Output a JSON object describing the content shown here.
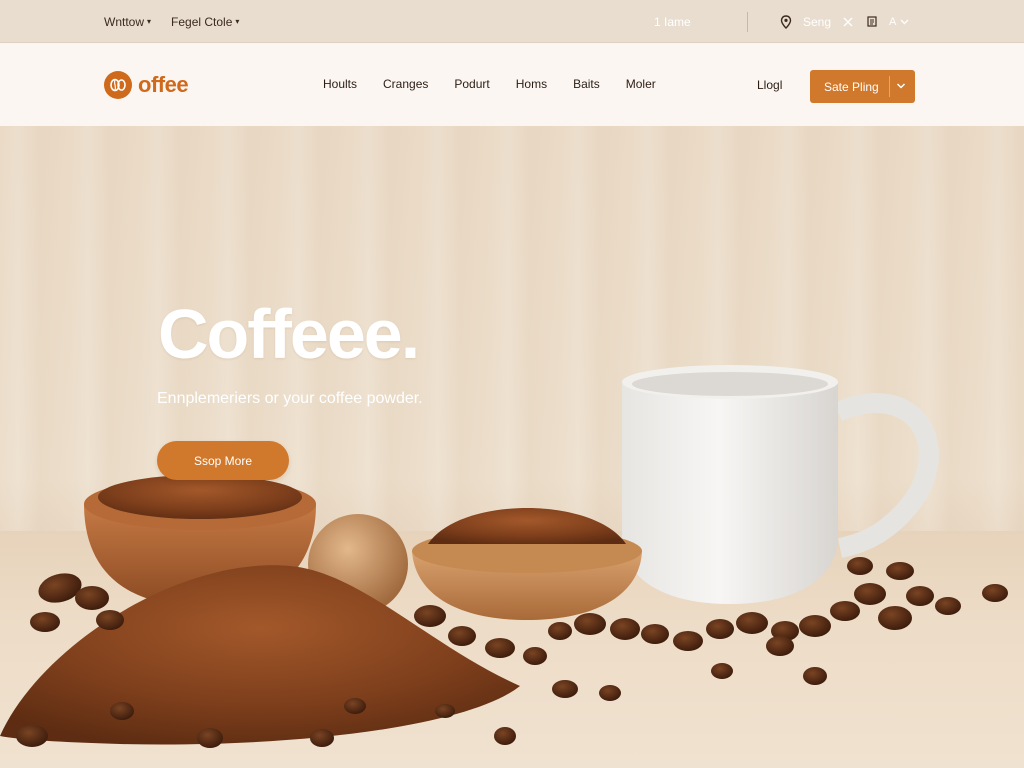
{
  "utility": {
    "left_menus": [
      {
        "label": "Wnttow"
      },
      {
        "label": "Fegel Ctole"
      }
    ],
    "home": "1 Iame",
    "sing": "Seng",
    "lang": "A"
  },
  "nav": {
    "logo_text": "offee",
    "links": [
      "Hoults",
      "Cranges",
      "Podurt",
      "Homs",
      "Baits",
      "Moler"
    ],
    "login": "Llogl",
    "cta_label": "Sate Pling"
  },
  "hero": {
    "title": "Coffeee.",
    "subtitle": "Ennplemeriers or your coffee powder.",
    "button_label": "Ssop More"
  },
  "colors": {
    "accent": "#d0782b",
    "logo": "#cf6a1d",
    "nav_bg": "#fbf6f1",
    "utility_bg": "#e9ddcf"
  },
  "icons": {
    "logo": "coffee-bean-logo-icon",
    "utility_1": "location-pin-icon",
    "utility_2": "close-icon",
    "utility_3": "document-icon",
    "lang_caret": "chevron-down-icon",
    "cta_caret": "chevron-down-icon"
  }
}
